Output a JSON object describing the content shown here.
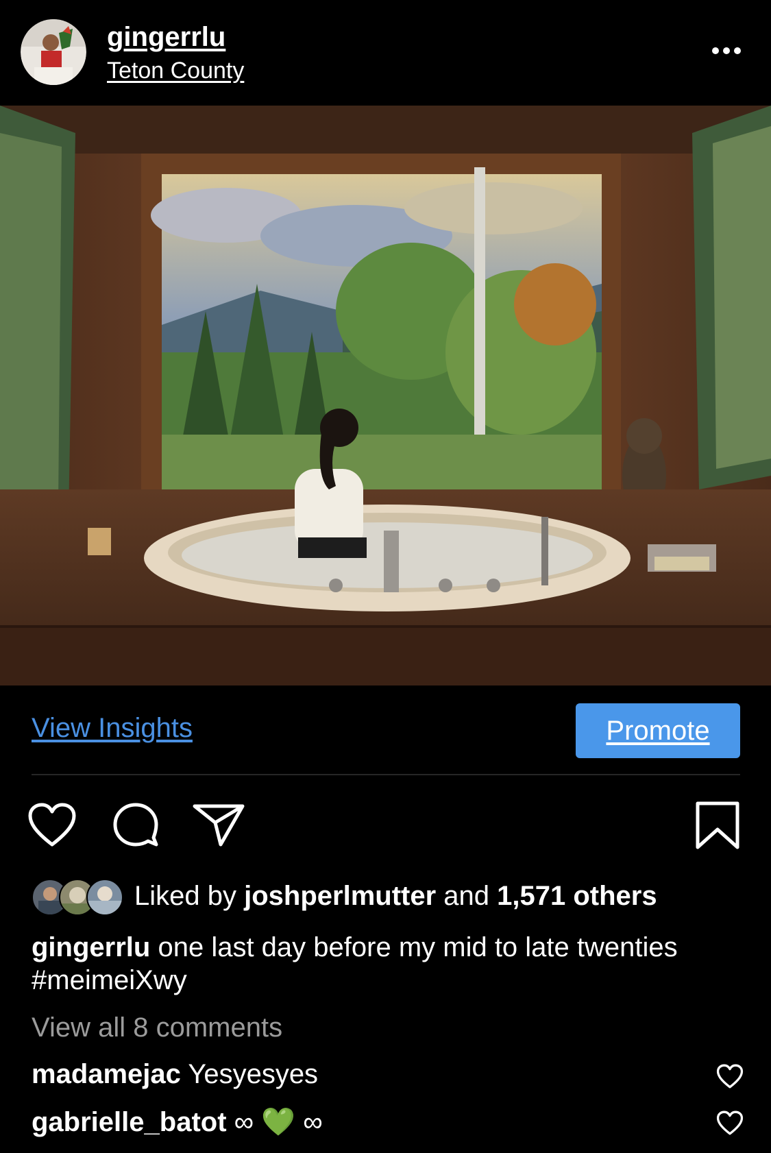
{
  "post": {
    "username": "gingerrlu",
    "location": "Teton County"
  },
  "actions": {
    "view_insights": "View Insights",
    "promote": "Promote"
  },
  "likes": {
    "prefix": "Liked by",
    "liker": "joshperlmutter",
    "conjunction": "and",
    "others": "1,571 others"
  },
  "caption": {
    "username": "gingerrlu",
    "text": "one last day before my mid to late twenties",
    "hashtag": "#meimeiXwy"
  },
  "comments_link": "View all 8 comments",
  "comments": [
    {
      "username": "madamejac",
      "text": "Yesyesyes"
    },
    {
      "username": "gabrielle_batot",
      "text": "∞ 💚 ∞"
    }
  ],
  "colors": {
    "accent": "#4a97ea",
    "link": "#4a90e2",
    "muted": "#9b9b9b"
  }
}
